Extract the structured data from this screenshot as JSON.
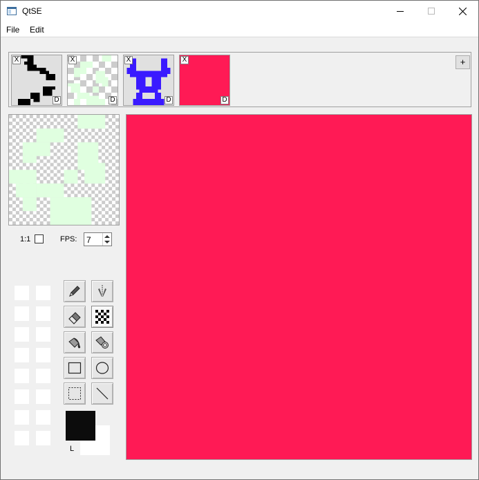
{
  "window": {
    "title": "QtSE",
    "controls": {
      "minimize": "minimize-icon",
      "maximize": "maximize-icon",
      "close": "close-icon"
    }
  },
  "menu": {
    "file": "File",
    "edit": "Edit"
  },
  "frames": {
    "remove_label": "X",
    "duplicate_label": "D",
    "add_label": "+",
    "items": [
      {
        "name": "frame-1",
        "color": "#000000",
        "selected": false
      },
      {
        "name": "frame-2",
        "color": "#e0ffe0",
        "selected": false
      },
      {
        "name": "frame-3",
        "color": "#3a1aff",
        "selected": false
      },
      {
        "name": "frame-4",
        "color": "#ff1a55",
        "selected": true
      }
    ]
  },
  "preview": {
    "ratio_label": "1:1",
    "ratio_checked": false,
    "fps_label": "FPS:",
    "fps_value": "7",
    "sprite_color": "#e0ffe0"
  },
  "tools": [
    {
      "name": "pencil-tool",
      "icon": "pencil-icon"
    },
    {
      "name": "mirror-pencil-tool",
      "icon": "mirror-pen-icon"
    },
    {
      "name": "eraser-tool",
      "icon": "eraser-icon"
    },
    {
      "name": "dither-tool",
      "icon": "checker-icon",
      "active": true
    },
    {
      "name": "fill-tool",
      "icon": "paint-bucket-icon"
    },
    {
      "name": "global-fill-tool",
      "icon": "paint-bucket-all-icon"
    },
    {
      "name": "rectangle-tool",
      "icon": "rectangle-icon"
    },
    {
      "name": "ellipse-tool",
      "icon": "ellipse-icon"
    },
    {
      "name": "selection-tool",
      "icon": "dashed-select-icon"
    },
    {
      "name": "line-tool",
      "icon": "line-icon"
    }
  ],
  "colors": {
    "primary": "#0c0c0c",
    "secondary": "#ffffff",
    "primary_label": "L"
  },
  "canvas": {
    "fill_color": "#ff1a55"
  }
}
